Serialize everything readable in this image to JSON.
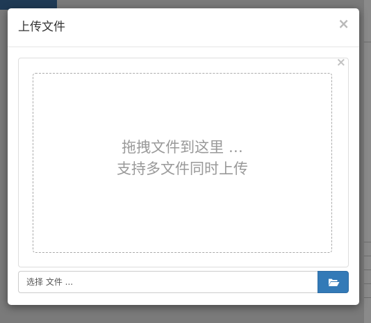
{
  "modal": {
    "title": "上传文件",
    "close_glyph": "×"
  },
  "drop_panel": {
    "remove_glyph": "×",
    "line1": "拖拽文件到这里 …",
    "line2": "支持多文件同时上传"
  },
  "file_input": {
    "placeholder": "选择 文件 ..."
  },
  "browse_button": {
    "icon": "folder-open-icon"
  },
  "colors": {
    "primary": "#337ab7",
    "backdrop": "#7a7a7a",
    "hint_text": "#999999"
  }
}
